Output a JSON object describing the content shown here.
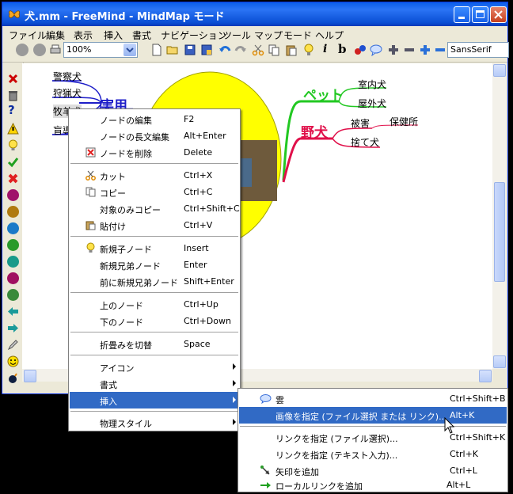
{
  "window": {
    "title": "犬.mm - FreeMind - MindMap モード"
  },
  "menubar": [
    "ファイル",
    "編集",
    "表示",
    "挿入",
    "書式",
    "ナビゲーション",
    "ツール",
    "マップ",
    "モード",
    "ヘルプ"
  ],
  "toolbar": {
    "zoom": "100%",
    "font": "SansSerif",
    "italic_label": "i",
    "bold_label": "b"
  },
  "mindmap": {
    "left_branch": "実用",
    "left_children": [
      "警察犬",
      "狩猟犬",
      "牧羊犬",
      "盲導"
    ],
    "pet_branch": "ペット",
    "pet_children": [
      "室内犬",
      "屋外犬"
    ],
    "wild_branch": "野犬",
    "wild_children": [
      "被害",
      "捨て犬"
    ],
    "wild_grandchild": "保健所"
  },
  "context_menu": {
    "items": [
      {
        "label": "ノードの編集",
        "shortcut": "F2",
        "icon": "none"
      },
      {
        "label": "ノードの長文編集",
        "shortcut": "Alt+Enter",
        "icon": "none"
      },
      {
        "label": "ノードを削除",
        "shortcut": "Delete",
        "icon": "delete-icon"
      },
      {
        "label": "カット",
        "shortcut": "Ctrl+X",
        "icon": "scissors-icon"
      },
      {
        "label": "コピー",
        "shortcut": "Ctrl+C",
        "icon": "copy-icon"
      },
      {
        "label": "対象のみコピー",
        "shortcut": "Ctrl+Shift+C",
        "icon": "none"
      },
      {
        "label": "貼付け",
        "shortcut": "Ctrl+V",
        "icon": "paste-icon"
      },
      {
        "label": "新規子ノード",
        "shortcut": "Insert",
        "icon": "lightbulb-icon"
      },
      {
        "label": "新規兄弟ノード",
        "shortcut": "Enter",
        "icon": "none"
      },
      {
        "label": "前に新規兄弟ノード",
        "shortcut": "Shift+Enter",
        "icon": "none"
      },
      {
        "label": "上のノード",
        "shortcut": "Ctrl+Up",
        "icon": "none"
      },
      {
        "label": "下のノード",
        "shortcut": "Ctrl+Down",
        "icon": "none"
      },
      {
        "label": "折畳みを切替",
        "shortcut": "Space",
        "icon": "none"
      },
      {
        "label": "アイコン",
        "shortcut": "",
        "icon": "none"
      },
      {
        "label": "書式",
        "shortcut": "",
        "icon": "none"
      },
      {
        "label": "挿入",
        "shortcut": "",
        "icon": "none"
      },
      {
        "label": "物理スタイル",
        "shortcut": "",
        "icon": "none"
      }
    ]
  },
  "submenu": {
    "items": [
      {
        "label": "雲",
        "shortcut": "Ctrl+Shift+B"
      },
      {
        "label": "画像を指定 (ファイル選択 または リンク)...",
        "shortcut": "Alt+K"
      },
      {
        "label": "リンクを指定 (ファイル選択)...",
        "shortcut": "Ctrl+Shift+K"
      },
      {
        "label": "リンクを指定 (テキスト入力)...",
        "shortcut": "Ctrl+K"
      },
      {
        "label": "矢印を追加",
        "shortcut": "Ctrl+L"
      },
      {
        "label": "ローカルリンクを追加",
        "shortcut": "Alt+L"
      }
    ]
  }
}
